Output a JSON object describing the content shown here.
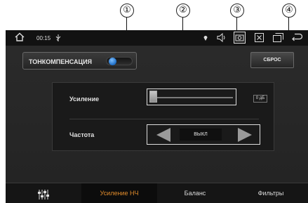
{
  "callouts": [
    "①",
    "②",
    "③",
    "④"
  ],
  "status_bar": {
    "time": "00:15",
    "icons": [
      "home-icon",
      "usb-icon",
      "location-icon",
      "volume-icon",
      "camera-icon",
      "close-box-icon",
      "window-icon",
      "back-icon"
    ]
  },
  "loudness": {
    "label": "ТОНКОМПЕНСАЦИЯ",
    "enabled": true
  },
  "reset_label": "СБРОС",
  "gain": {
    "label": "Усиление",
    "value": "0 дБ",
    "level": 0
  },
  "frequency": {
    "label": "Частота",
    "value": "ВЫКЛ"
  },
  "tabs": [
    {
      "label": "",
      "icon": "equalizer-icon",
      "active": false
    },
    {
      "label": "Усиление НЧ",
      "active": true
    },
    {
      "label": "Баланс",
      "active": false
    },
    {
      "label": "Фильтры",
      "active": false
    }
  ],
  "colors": {
    "accent": "#e08b2b",
    "toggle": "#1b6bc4",
    "background": "#2a2a2a"
  }
}
